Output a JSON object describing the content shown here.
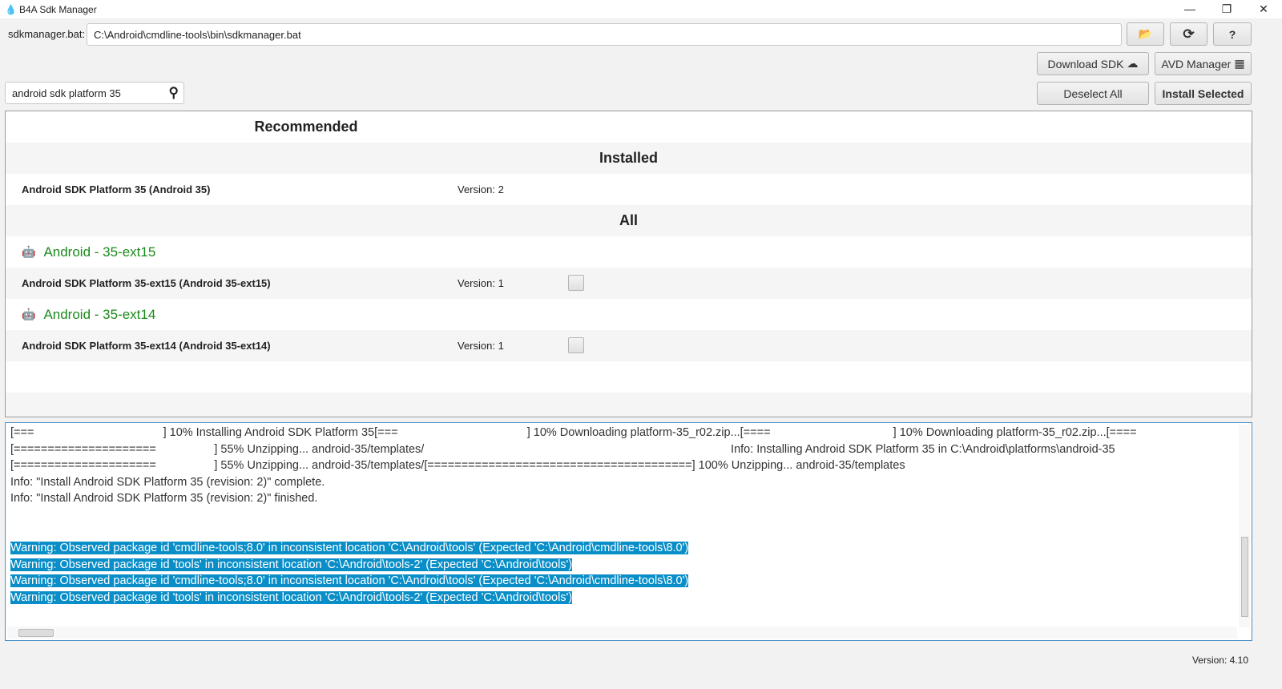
{
  "window": {
    "title": "B4A Sdk Manager",
    "minimize": "—",
    "maximize": "❐",
    "close": "✕"
  },
  "sdk": {
    "label": "sdkmanager.bat:",
    "path": "C:\\Android\\cmdline-tools\\bin\\sdkmanager.bat"
  },
  "toolbar": {
    "download_sdk": "Download SDK",
    "avd_manager": "AVD Manager",
    "deselect_all": "Deselect All",
    "install_selected": "Install Selected",
    "help": "?"
  },
  "search": {
    "value": "android sdk platform 35"
  },
  "list": {
    "recommended": "Recommended",
    "installed": "Installed",
    "all": "All",
    "installed_items": [
      {
        "name": "Android SDK Platform 35 (Android 35)",
        "version": "Version: 2"
      }
    ],
    "groups": [
      {
        "title": "Android - 35-ext15",
        "item": "Android SDK Platform 35-ext15 (Android 35-ext15)",
        "version": "Version: 1"
      },
      {
        "title": "Android - 35-ext14",
        "item": "Android SDK Platform 35-ext14 (Android 35-ext14)",
        "version": "Version: 1"
      }
    ]
  },
  "log": {
    "lines": [
      "[===                                        ] 10% Installing Android SDK Platform 35[===                                        ] 10% Downloading platform-35_r02.zip...[====                                      ] 10% Downloading platform-35_r02.zip...[====",
      "[=====================                  ] 55% Unzipping... android-35/templates/                                                                                               Info: Installing Android SDK Platform 35 in C:\\Android\\platforms\\android-35",
      "[=====================                  ] 55% Unzipping... android-35/templates/[=======================================] 100% Unzipping... android-35/templates",
      "Info: \"Install Android SDK Platform 35 (revision: 2)\" complete.",
      "Info: \"Install Android SDK Platform 35 (revision: 2)\" finished.",
      "",
      ""
    ],
    "warnings": [
      "Warning: Observed package id 'cmdline-tools;8.0' in inconsistent location 'C:\\Android\\tools' (Expected 'C:\\Android\\cmdline-tools\\8.0')",
      "Warning: Observed package id 'tools' in inconsistent location 'C:\\Android\\tools-2' (Expected 'C:\\Android\\tools')",
      "Warning: Observed package id 'cmdline-tools;8.0' in inconsistent location 'C:\\Android\\tools' (Expected 'C:\\Android\\cmdline-tools\\8.0')",
      "Warning: Observed package id 'tools' in inconsistent location 'C:\\Android\\tools-2' (Expected 'C:\\Android\\tools')"
    ]
  },
  "footer": {
    "version": "Version: 4.10"
  }
}
